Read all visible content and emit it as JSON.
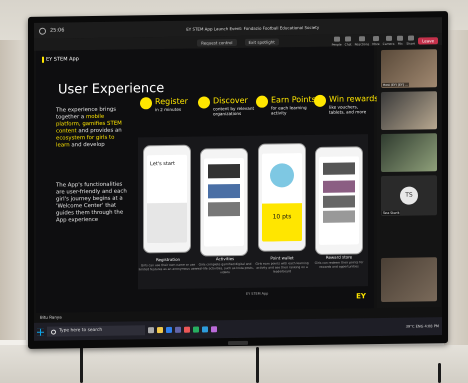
{
  "teams": {
    "time": "25:06",
    "window_title": "EY STEM App Launch Event: Fondazio Football Educational Society",
    "request_control": "Request control",
    "exit_spotlight": "Exit spotlight",
    "controls": [
      "People",
      "Chat",
      "Reactions",
      "More",
      "Camera",
      "Mic",
      "Share"
    ],
    "leave": "Leave",
    "presenter": "Bitu Ranya"
  },
  "slide": {
    "app_badge": "EY STEM App",
    "title": "User Experience",
    "para1_pre": "The experience brings together a ",
    "para1_hl1": "mobile platform, gamifies STEM content",
    "para1_mid": " and provides an ",
    "para1_hl2": "ecosystem for girls to learn",
    "para1_post": " and develop",
    "para2": "The App's functionalities are user-friendly and each girl's journey begins at a 'Welcome Center' that guides them through the App experience",
    "steps": [
      {
        "title": "Register",
        "sub": "in 2 minutes"
      },
      {
        "title": "Discover",
        "sub": "content by relevant organizations"
      },
      {
        "title": "Earn Points",
        "sub": "for each learning activity"
      },
      {
        "title": "Win rewards",
        "sub": "like vouchers, tablets, and more"
      }
    ],
    "phone_texts": {
      "lets_start": "Let's start",
      "points": "10 pts"
    },
    "captions": [
      {
        "title": "Registration",
        "desc": "Girls can use their own name or use limited features as an anonymous user"
      },
      {
        "title": "Activities",
        "desc": "Girls complete gamified digital and real-life activities, such as Insta posts, videos"
      },
      {
        "title": "Point wallet",
        "desc": "Girls earn points with each learning activity and see their ranking on a leaderboard"
      },
      {
        "title": "Reward store",
        "desc": "Girls can redeem their points for rewards and opportunities"
      }
    ],
    "footer": "EY STEM App",
    "ey": "EY"
  },
  "gallery": {
    "label1": "Host (EY) [EY] ...",
    "avatar": "TS",
    "label4": "Tess Skarik"
  },
  "taskbar": {
    "search": "Type here to search",
    "tray": "39°C  ENG  4:08 PM"
  }
}
